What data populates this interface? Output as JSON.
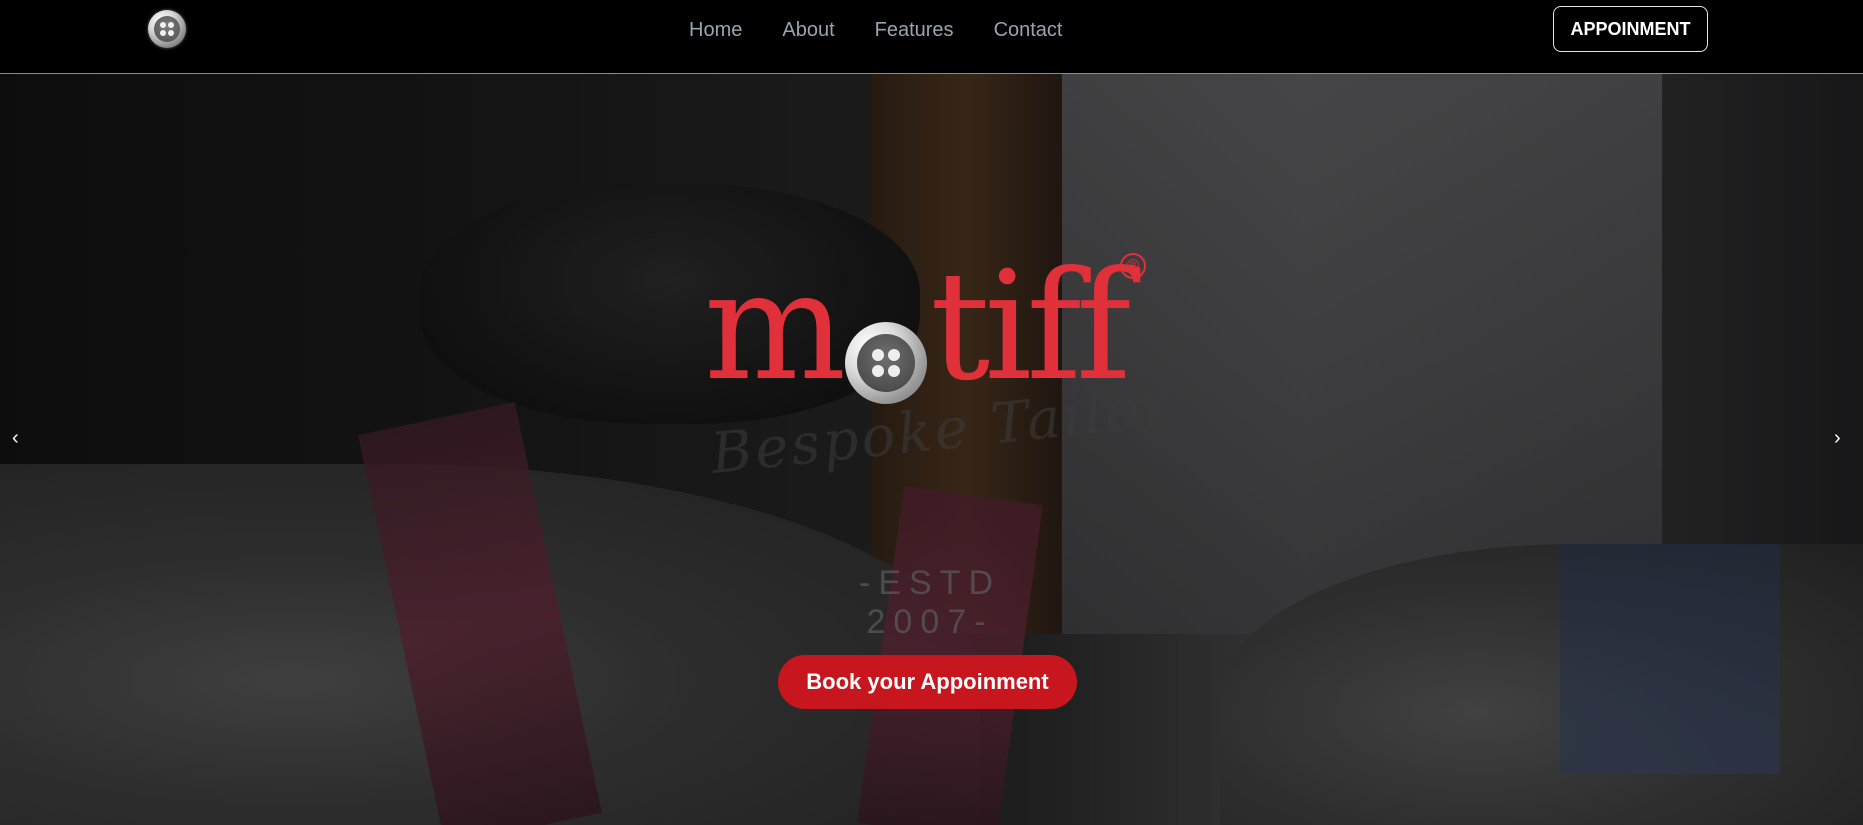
{
  "header": {
    "nav": [
      "Home",
      "About",
      "Features",
      "Contact"
    ],
    "cta_label": "APPOINMENT"
  },
  "hero": {
    "logo_text_m": "m",
    "logo_text_tiff": "tiff",
    "registered_mark": "®",
    "tagline": "Bespoke Tailor",
    "estd": "-ESTD 2007-",
    "book_label": "Book your Appoinment",
    "prev_arrow": "‹",
    "next_arrow": "›"
  },
  "colors": {
    "brand_red": "#e0303a",
    "button_red": "#c8161e",
    "nav_text": "#9aa3b2"
  },
  "icons": {
    "nav_logo": "button-logo-icon",
    "hero_logo_o": "button-logo-icon"
  }
}
